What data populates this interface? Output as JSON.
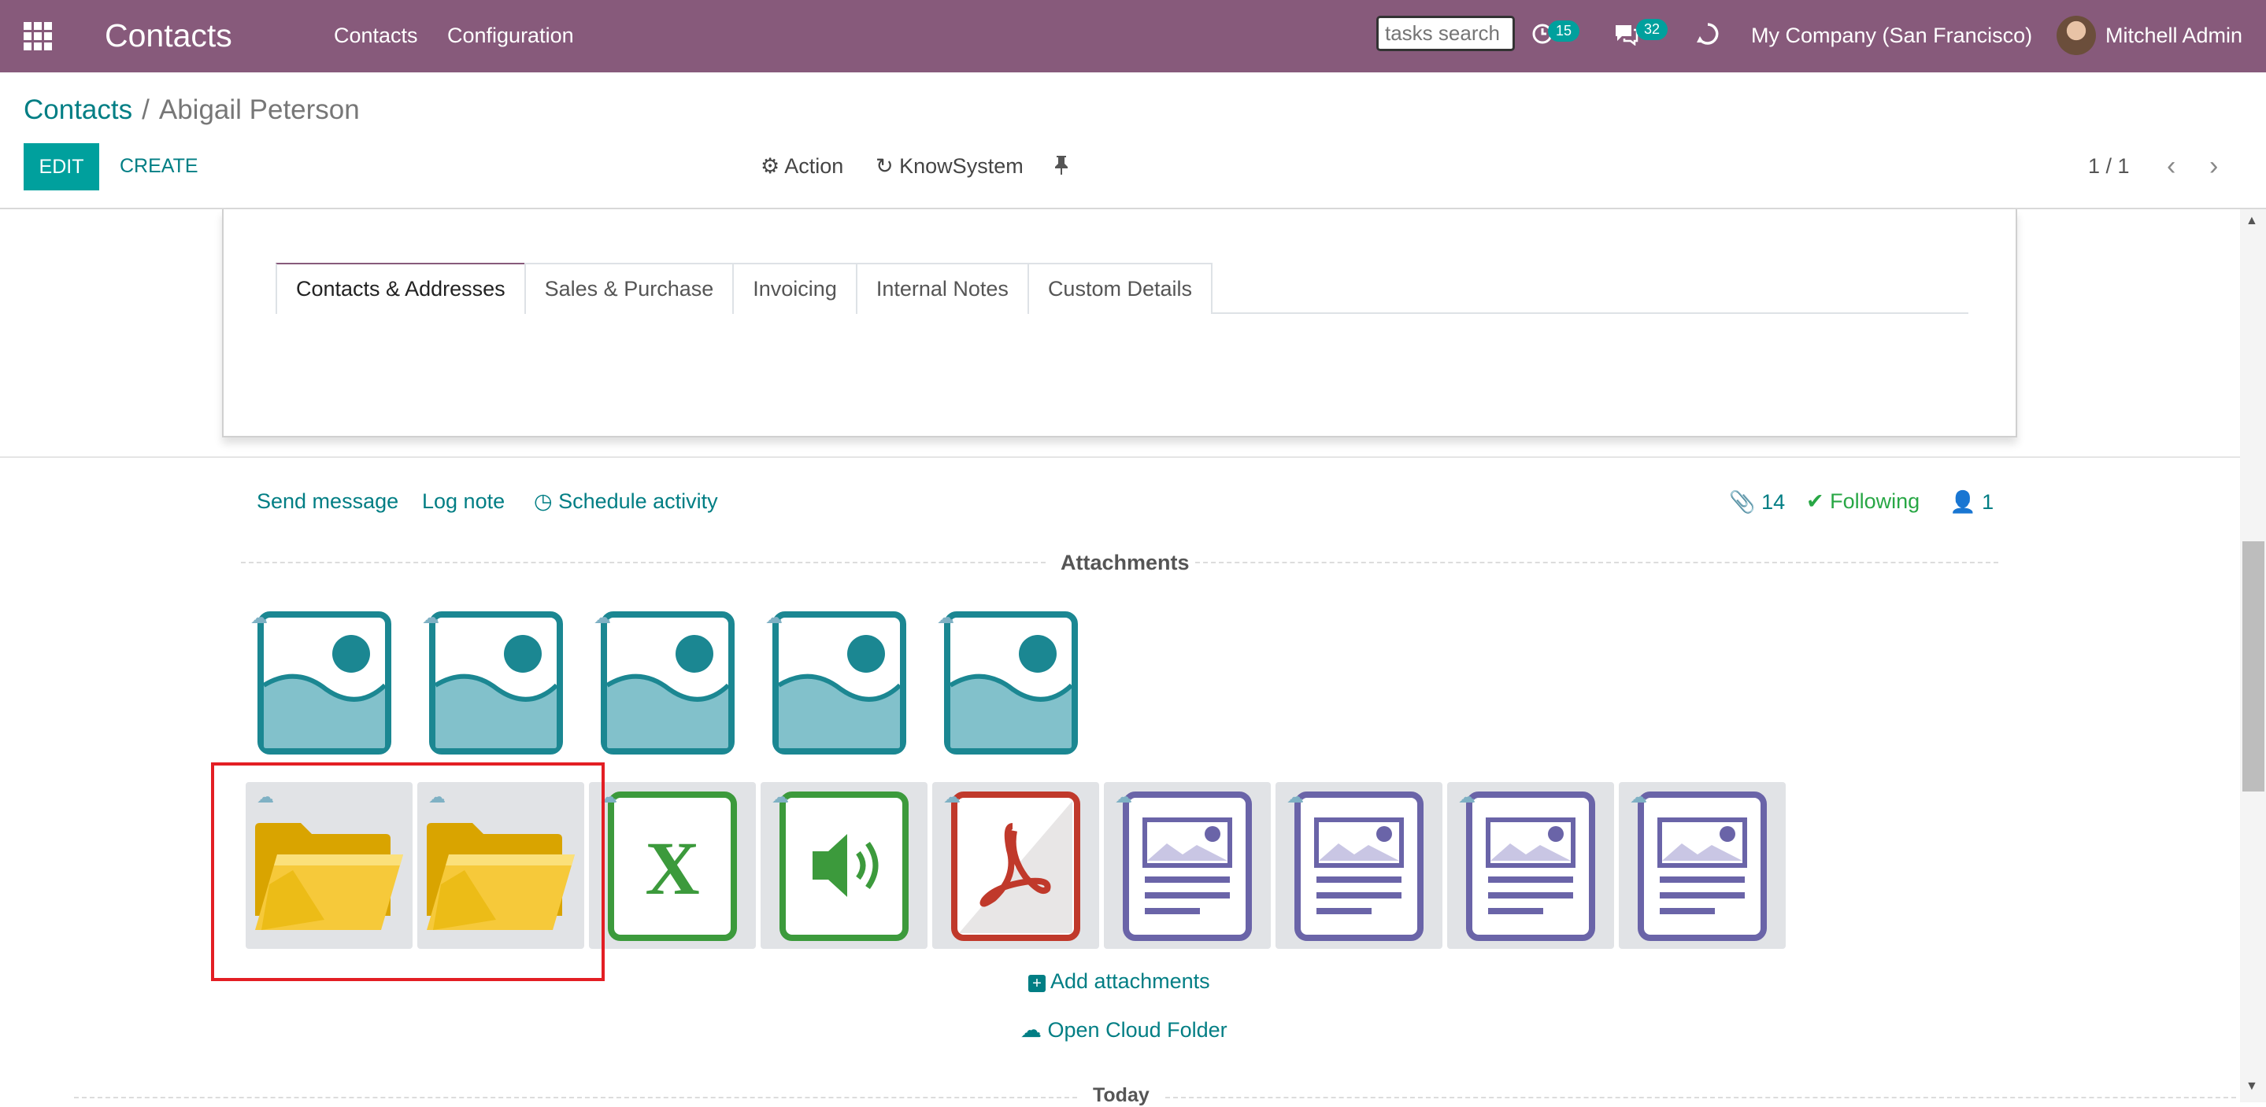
{
  "navbar": {
    "app_title": "Contacts",
    "menu": [
      "Contacts",
      "Configuration"
    ],
    "search_placeholder": "tasks search",
    "activity_count": "15",
    "message_count": "32",
    "company": "My Company (San Francisco)",
    "user": "Mitchell Admin"
  },
  "breadcrumb": {
    "parent": "Contacts",
    "separator": "/",
    "current": "Abigail Peterson"
  },
  "control_panel": {
    "edit_label": "EDIT",
    "create_label": "CREATE",
    "action_label": "Action",
    "knowsystem_label": "KnowSystem",
    "pager": "1 / 1"
  },
  "tabs": [
    "Contacts & Addresses",
    "Sales & Purchase",
    "Invoicing",
    "Internal Notes",
    "Custom Details"
  ],
  "chatter": {
    "send_message": "Send message",
    "log_note": "Log note",
    "schedule_activity": "Schedule activity",
    "attachment_count": "14",
    "following": "Following",
    "follower_count": "1",
    "attachments_title": "Attachments",
    "add_attachments": "Add attachments",
    "open_cloud_folder": "Open Cloud Folder",
    "today": "Today"
  },
  "attachments": {
    "images": [
      "image",
      "image",
      "image",
      "image",
      "image"
    ],
    "files": [
      "folder",
      "folder",
      "spreadsheet",
      "audio",
      "pdf",
      "document",
      "document",
      "document",
      "document"
    ]
  },
  "colors": {
    "navbar": "#875a7b",
    "accent": "#017e84",
    "primary_button": "#00a09d",
    "image_icon": "#1b8792",
    "folder": "#f4c430",
    "excel": "#3c9a3c",
    "pdf": "#c0392b",
    "document": "#6a64a8",
    "selection": "#e31e24"
  }
}
